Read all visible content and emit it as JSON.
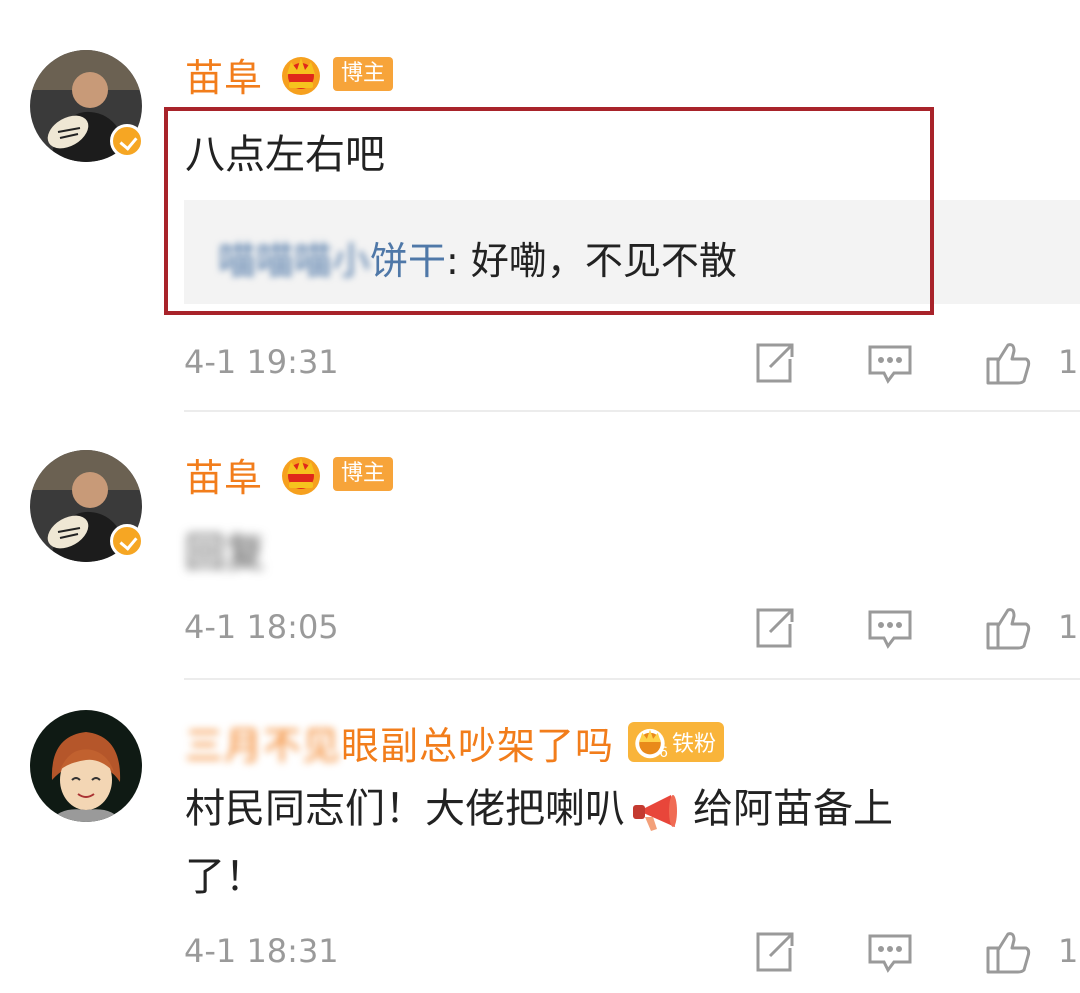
{
  "comments": [
    {
      "username": "苗阜",
      "badge": "博主",
      "text": "八点左右吧",
      "reply": {
        "user_blurred": "喵喵喵小",
        "user_visible": "饼干",
        "separator": ": ",
        "text": "好嘞，不见不散"
      },
      "time": "4-1 19:31",
      "likes": "1"
    },
    {
      "username": "苗阜",
      "badge": "博主",
      "text_blurred": "回复",
      "time": "4-1 18:05",
      "likes": "1"
    },
    {
      "username_blurred": "三月不见",
      "username_visible": "眼副总吵架了吗",
      "fan_level": "6",
      "badge": "铁粉",
      "text_line1": "村民同志们！大佬把喇叭",
      "text_line1b": "给阿苗备上",
      "text_line2": "了！",
      "time": "4-1 18:31",
      "likes": "1"
    }
  ],
  "icons": {
    "share": "share-icon",
    "comment": "comment-icon",
    "like": "like-icon",
    "crown": "crown-icon",
    "verified": "verified-icon",
    "megaphone": "megaphone-icon"
  },
  "colors": {
    "username": "#f27d1b",
    "badge": "#f7a43a",
    "reply_user": "#4f78a8",
    "highlight_border": "#a8232a",
    "meta": "#9a9a9a"
  }
}
